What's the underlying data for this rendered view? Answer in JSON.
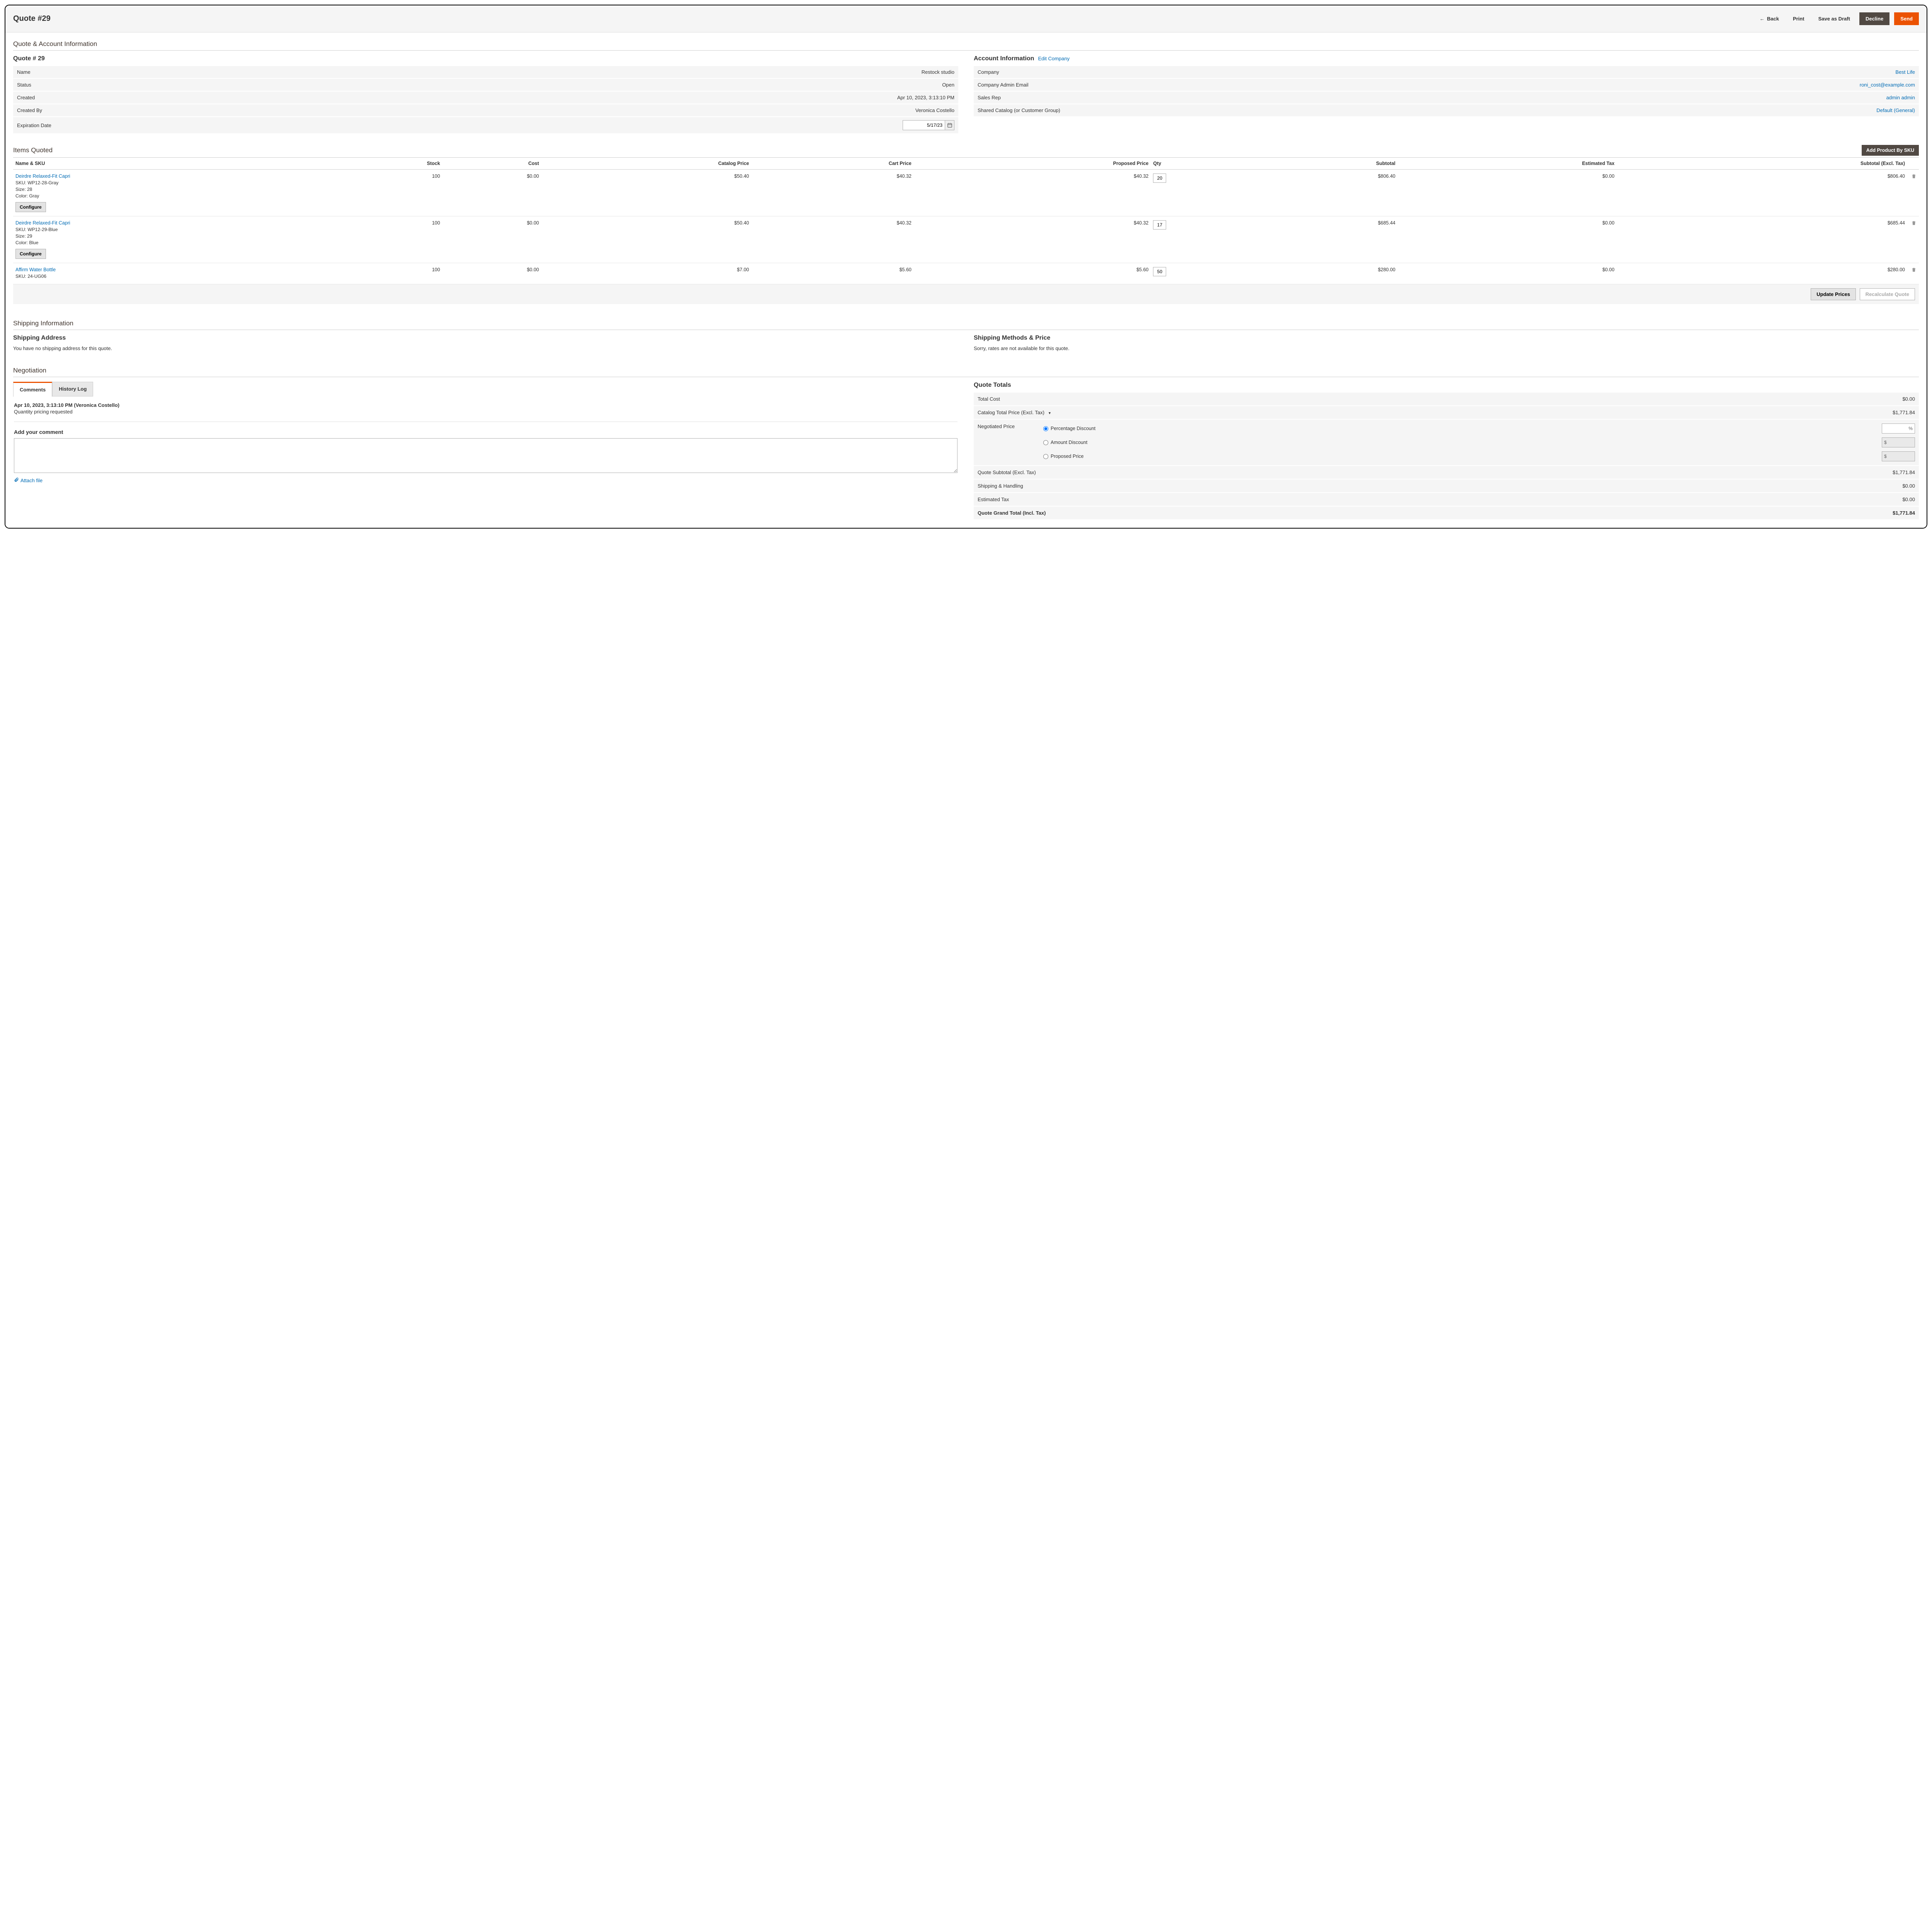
{
  "header": {
    "title": "Quote #29",
    "back": "Back",
    "print": "Print",
    "save_draft": "Save as Draft",
    "decline": "Decline",
    "send": "Send"
  },
  "sections": {
    "quote_account": "Quote & Account Information",
    "items_quoted": "Items Quoted",
    "shipping_info": "Shipping Information",
    "negotiation": "Negotiation"
  },
  "quote": {
    "heading": "Quote # 29",
    "labels": {
      "name": "Name",
      "status": "Status",
      "created": "Created",
      "created_by": "Created By",
      "expiration": "Expiration Date"
    },
    "name": "Restock studio",
    "status": "Open",
    "created": "Apr 10, 2023, 3:13:10 PM",
    "created_by": "Veronica Costello",
    "expiration": "5/17/23"
  },
  "account": {
    "heading": "Account Information",
    "edit": "Edit Company",
    "labels": {
      "company": "Company",
      "admin_email": "Company Admin Email",
      "sales_rep": "Sales Rep",
      "catalog": "Shared Catalog (or Customer Group)"
    },
    "company": "Best Life",
    "admin_email": "roni_cost@example.com",
    "sales_rep": "admin admin",
    "catalog": "Default (General)"
  },
  "items": {
    "add_sku": "Add Product By SKU",
    "cols": {
      "name": "Name & SKU",
      "stock": "Stock",
      "cost": "Cost",
      "catalog_price": "Catalog Price",
      "cart_price": "Cart Price",
      "proposed_price": "Proposed Price",
      "qty": "Qty",
      "subtotal": "Subtotal",
      "est_tax": "Estimated Tax",
      "subtotal_excl": "Subtotal (Excl. Tax)"
    },
    "rows": [
      {
        "name": "Deirdre Relaxed-Fit Capri",
        "sku": "WP12-28-Gray",
        "size": "28",
        "color": "Gray",
        "stock": "100",
        "cost": "$0.00",
        "catalog_price": "$50.40",
        "cart_price": "$40.32",
        "proposed_price": "$40.32",
        "qty": "20",
        "subtotal": "$806.40",
        "est_tax": "$0.00",
        "subtotal_excl": "$806.40",
        "configurable": true
      },
      {
        "name": "Deirdre Relaxed-Fit Capri",
        "sku": "WP12-29-Blue",
        "size": "29",
        "color": "Blue",
        "stock": "100",
        "cost": "$0.00",
        "catalog_price": "$50.40",
        "cart_price": "$40.32",
        "proposed_price": "$40.32",
        "qty": "17",
        "subtotal": "$685.44",
        "est_tax": "$0.00",
        "subtotal_excl": "$685.44",
        "configurable": true
      },
      {
        "name": "Affirm Water Bottle",
        "sku": "24-UG06",
        "stock": "100",
        "cost": "$0.00",
        "catalog_price": "$7.00",
        "cart_price": "$5.60",
        "proposed_price": "$5.60",
        "qty": "50",
        "subtotal": "$280.00",
        "est_tax": "$0.00",
        "subtotal_excl": "$280.00",
        "configurable": false
      }
    ],
    "sku_prefix": "SKU: ",
    "size_prefix": "Size:  ",
    "color_prefix": "Color:  ",
    "configure": "Configure",
    "update_prices": "Update Prices",
    "recalculate": "Recalculate Quote"
  },
  "shipping": {
    "address_heading": "Shipping Address",
    "address_msg": "You have no shipping address for this quote.",
    "methods_heading": "Shipping Methods & Price",
    "methods_msg": "Sorry, rates are not available for this quote."
  },
  "negotiation": {
    "tabs": {
      "comments": "Comments",
      "history": "History Log"
    },
    "comment_head": "Apr 10, 2023, 3:13:10 PM (Veronica Costello)",
    "comment_body": "Quantity pricing requested",
    "add_comment": "Add your comment",
    "attach": "Attach file"
  },
  "totals": {
    "heading": "Quote Totals",
    "labels": {
      "total_cost": "Total Cost",
      "catalog_total": "Catalog Total Price (Excl. Tax)",
      "negotiated": "Negotiated Price",
      "pct_discount": "Percentage Discount",
      "amt_discount": "Amount Discount",
      "proposed": "Proposed Price",
      "subtotal": "Quote Subtotal (Excl. Tax)",
      "shipping": "Shipping & Handling",
      "est_tax": "Estimated Tax",
      "grand_total": "Quote Grand Total (Incl. Tax)"
    },
    "total_cost": "$0.00",
    "catalog_total": "$1,771.84",
    "pct_symbol": "%",
    "currency_symbol": "$",
    "subtotal": "$1,771.84",
    "shipping": "$0.00",
    "est_tax": "$0.00",
    "grand_total": "$1,771.84"
  }
}
